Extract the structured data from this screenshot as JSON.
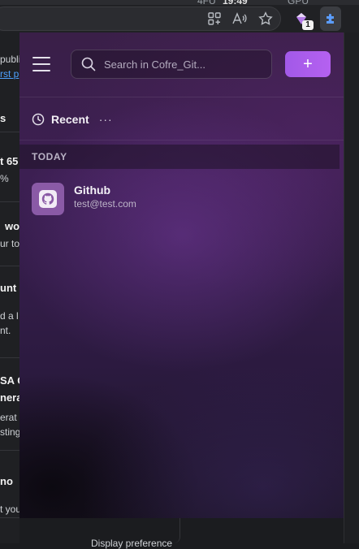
{
  "browser": {
    "top_strip_left": "4FU",
    "top_strip_time": "19:49",
    "top_strip_right": "GPU",
    "extension_badge": "1"
  },
  "background_page": {
    "fragments": [
      {
        "text": "publi",
        "style": "normal"
      },
      {
        "text": "rst p",
        "style": "link"
      },
      {
        "text": "s",
        "style": "bold"
      },
      {
        "text": "t 65",
        "style": "bold"
      },
      {
        "text": "%",
        "style": "normal"
      },
      {
        "text": "wo",
        "style": "bold"
      },
      {
        "text": "ur to",
        "style": "normal"
      },
      {
        "text": "unt",
        "style": "bold"
      },
      {
        "text": "d a l",
        "style": "normal"
      },
      {
        "text": "nt.",
        "style": "normal"
      },
      {
        "text": "SA G",
        "style": "bold"
      },
      {
        "text": "nera",
        "style": "bold"
      },
      {
        "text": "erat",
        "style": "normal"
      },
      {
        "text": "sting",
        "style": "normal"
      },
      {
        "text": "no",
        "style": "bold"
      },
      {
        "text": "t you",
        "style": "normal"
      }
    ],
    "bottom_text": "Display preference"
  },
  "popup": {
    "search": {
      "placeholder": "Search in Cofre_Git..."
    },
    "add_button_label": "+",
    "recent_label": "Recent",
    "recent_more": "···",
    "groups": [
      {
        "header": "TODAY",
        "items": [
          {
            "title": "Github",
            "subtitle": "test@test.com",
            "icon": "github-icon"
          }
        ]
      }
    ]
  },
  "colors": {
    "accent": "#a95cec",
    "item_icon_bg": "#8a5aa6",
    "popup_bg": "#3c1f52"
  }
}
